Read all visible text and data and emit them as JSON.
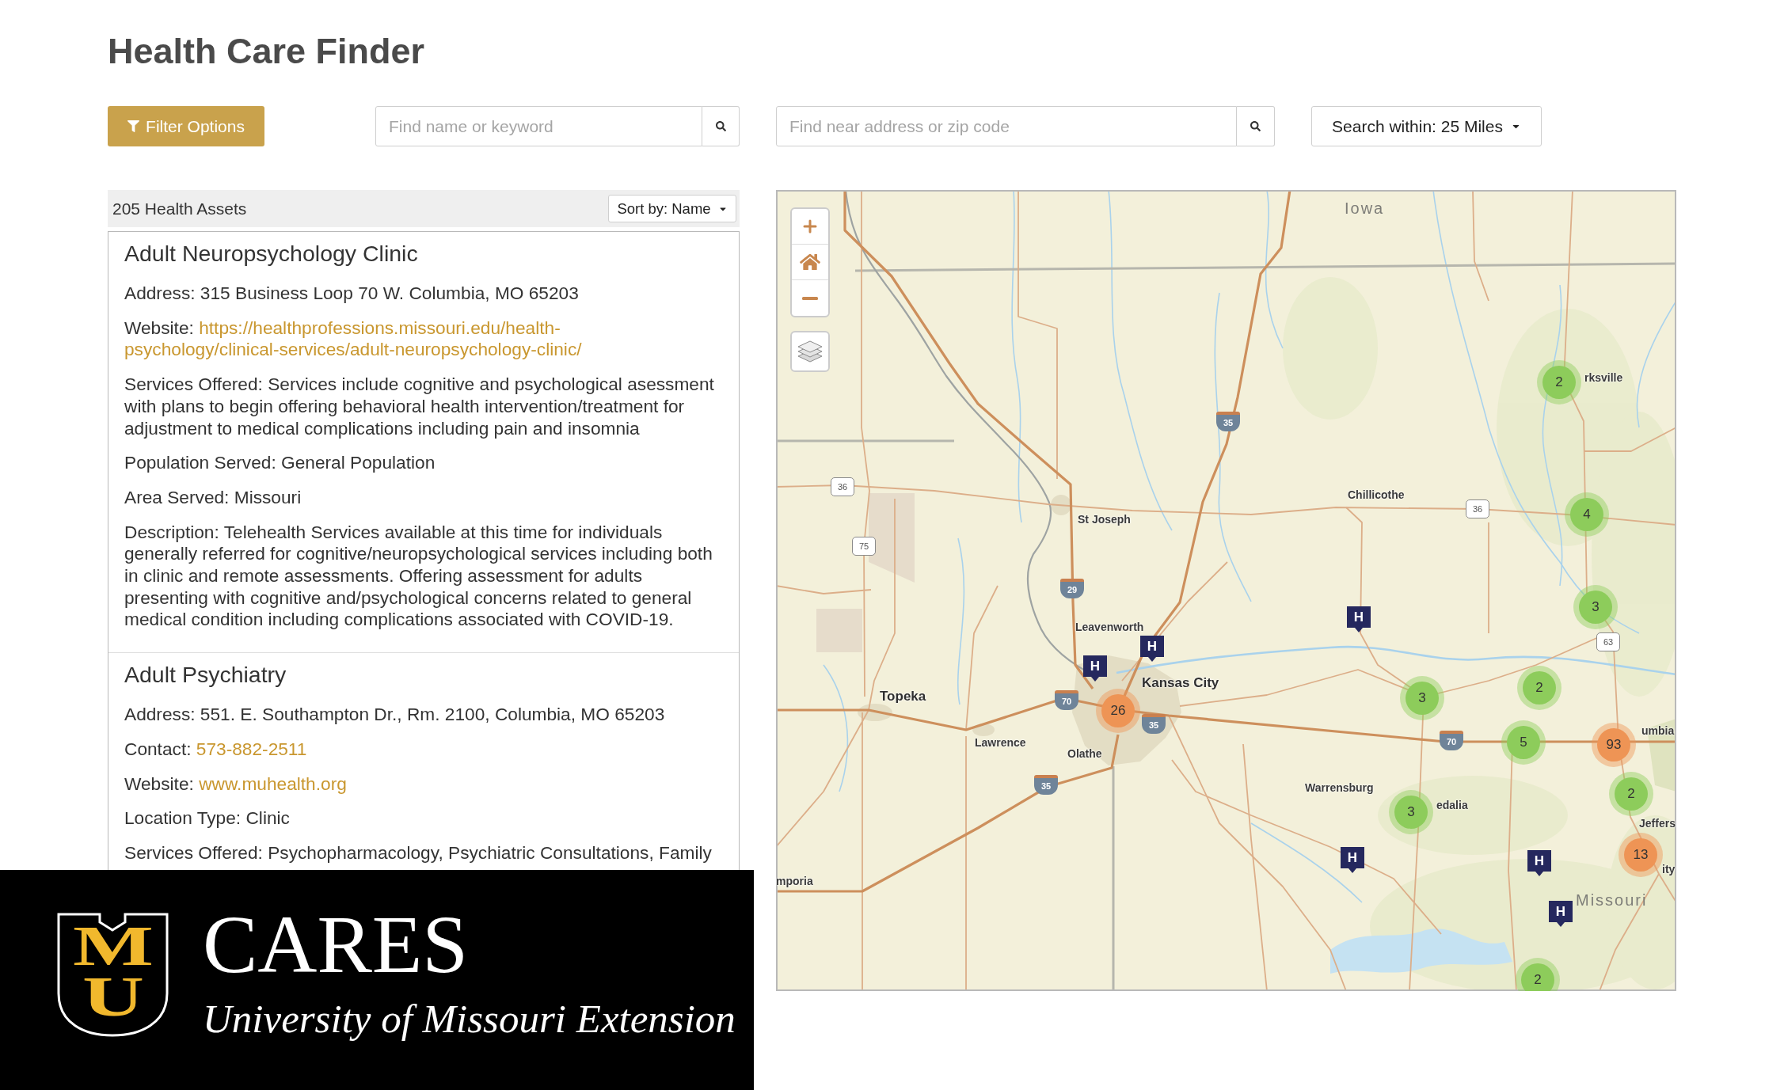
{
  "page": {
    "title": "Health Care Finder"
  },
  "toolbar": {
    "filter_button": {
      "label": "Filter Options"
    },
    "name_search": {
      "placeholder": "Find name or keyword"
    },
    "address_search": {
      "placeholder": "Find near address or zip code"
    },
    "distance_dropdown": {
      "label": "Search within: 25 Miles"
    }
  },
  "results": {
    "count": "205 Health Assets",
    "sort_dropdown": {
      "label": "Sort by: Name"
    },
    "assets": [
      {
        "name": "Adult Neuropsychology Clinic",
        "fields": [
          {
            "kind": "text",
            "label": "Address:",
            "value": "315 Business Loop 70 W. Columbia, MO 65203"
          },
          {
            "kind": "link",
            "label": "Website:",
            "lines": [
              "https://healthprofessions.missouri.edu/health-",
              "psychology/clinical-services/adult-neuropsychology-clinic/"
            ]
          },
          {
            "kind": "text",
            "label": "Services Offered:",
            "value": "Services include cognitive and psychological asessment with plans to begin offering behavioral health intervention/treatment for adjustment to medical complications including pain and insomnia"
          },
          {
            "kind": "text",
            "label": "Population Served:",
            "value": "General Population"
          },
          {
            "kind": "text",
            "label": "Area Served:",
            "value": "Missouri"
          },
          {
            "kind": "text",
            "label": "Description:",
            "value": "Telehealth Services available at this time for individuals generally referred for cognitive/neuropsychological services including both in clinic and remote assessments. Offering assessment for adults presenting with cognitive and/psychological concerns related to general medical condition including complications associated with COVID-19."
          }
        ]
      },
      {
        "name": "Adult Psychiatry",
        "fields": [
          {
            "kind": "text",
            "label": "Address:",
            "value": "551. E. Southampton Dr., Rm. 2100, Columbia, MO 65203"
          },
          {
            "kind": "link",
            "label": "Contact:",
            "lines": [
              "573-882-2511"
            ]
          },
          {
            "kind": "link",
            "label": "Website:",
            "lines": [
              "www.muhealth.org"
            ]
          },
          {
            "kind": "text",
            "label": "Location Type:",
            "value": "Clinic"
          },
          {
            "kind": "text",
            "label": "Services Offered:",
            "value": "Psychopharmacology, Psychiatric Consultations, Family"
          }
        ]
      }
    ]
  },
  "map": {
    "labels": [
      {
        "kind": "region",
        "text": "Iowa"
      },
      {
        "kind": "city",
        "text": "rksville"
      },
      {
        "kind": "city",
        "text": "Chillicothe"
      },
      {
        "kind": "city",
        "text": "St Joseph"
      },
      {
        "kind": "city",
        "text": "Leavenworth"
      },
      {
        "kind": "major_city",
        "text": "Kansas City"
      },
      {
        "kind": "major_city",
        "text": "Topeka"
      },
      {
        "kind": "city",
        "text": "Lawrence"
      },
      {
        "kind": "city",
        "text": "Olathe"
      },
      {
        "kind": "city",
        "text": "Warrensburg"
      },
      {
        "kind": "city",
        "text": "edalia"
      },
      {
        "kind": "city",
        "text": "umbia"
      },
      {
        "kind": "city",
        "text": "Jeffers"
      },
      {
        "kind": "city",
        "text": "ity"
      },
      {
        "kind": "region",
        "text": "Missouri"
      },
      {
        "kind": "city",
        "text": "mporia"
      }
    ],
    "shields": [
      {
        "kind": "interstate",
        "label": "35"
      },
      {
        "kind": "us",
        "label": "36"
      },
      {
        "kind": "us",
        "label": "36"
      },
      {
        "kind": "us",
        "label": "75"
      },
      {
        "kind": "interstate",
        "label": "29"
      },
      {
        "kind": "us",
        "label": "63"
      },
      {
        "kind": "interstate",
        "label": "70"
      },
      {
        "kind": "interstate",
        "label": "35"
      },
      {
        "kind": "interstate",
        "label": "70"
      },
      {
        "kind": "interstate",
        "label": "35"
      }
    ],
    "clusters": [
      {
        "count": "2",
        "color": "#8dcc5b"
      },
      {
        "count": "4",
        "color": "#8dcc5b"
      },
      {
        "count": "3",
        "color": "#8dcc5b"
      },
      {
        "count": "2",
        "color": "#8dcc5b"
      },
      {
        "count": "3",
        "color": "#8dcc5b"
      },
      {
        "count": "26",
        "color": "#ee9455"
      },
      {
        "count": "5",
        "color": "#8dcc5b"
      },
      {
        "count": "93",
        "color": "#ee9455"
      },
      {
        "count": "2",
        "color": "#8dcc5b"
      },
      {
        "count": "3",
        "color": "#8dcc5b"
      },
      {
        "count": "13",
        "color": "#ee9455"
      },
      {
        "count": "2",
        "color": "#8dcc5b"
      }
    ],
    "hospital_markers": [
      {
        "label": "H"
      },
      {
        "label": "H"
      },
      {
        "label": "H"
      },
      {
        "label": "H"
      },
      {
        "label": "H"
      },
      {
        "label": "H"
      }
    ]
  },
  "logo": {
    "letters": [
      "M",
      "U"
    ],
    "title": "CARES",
    "subtitle": "University of Missouri Extension"
  }
}
